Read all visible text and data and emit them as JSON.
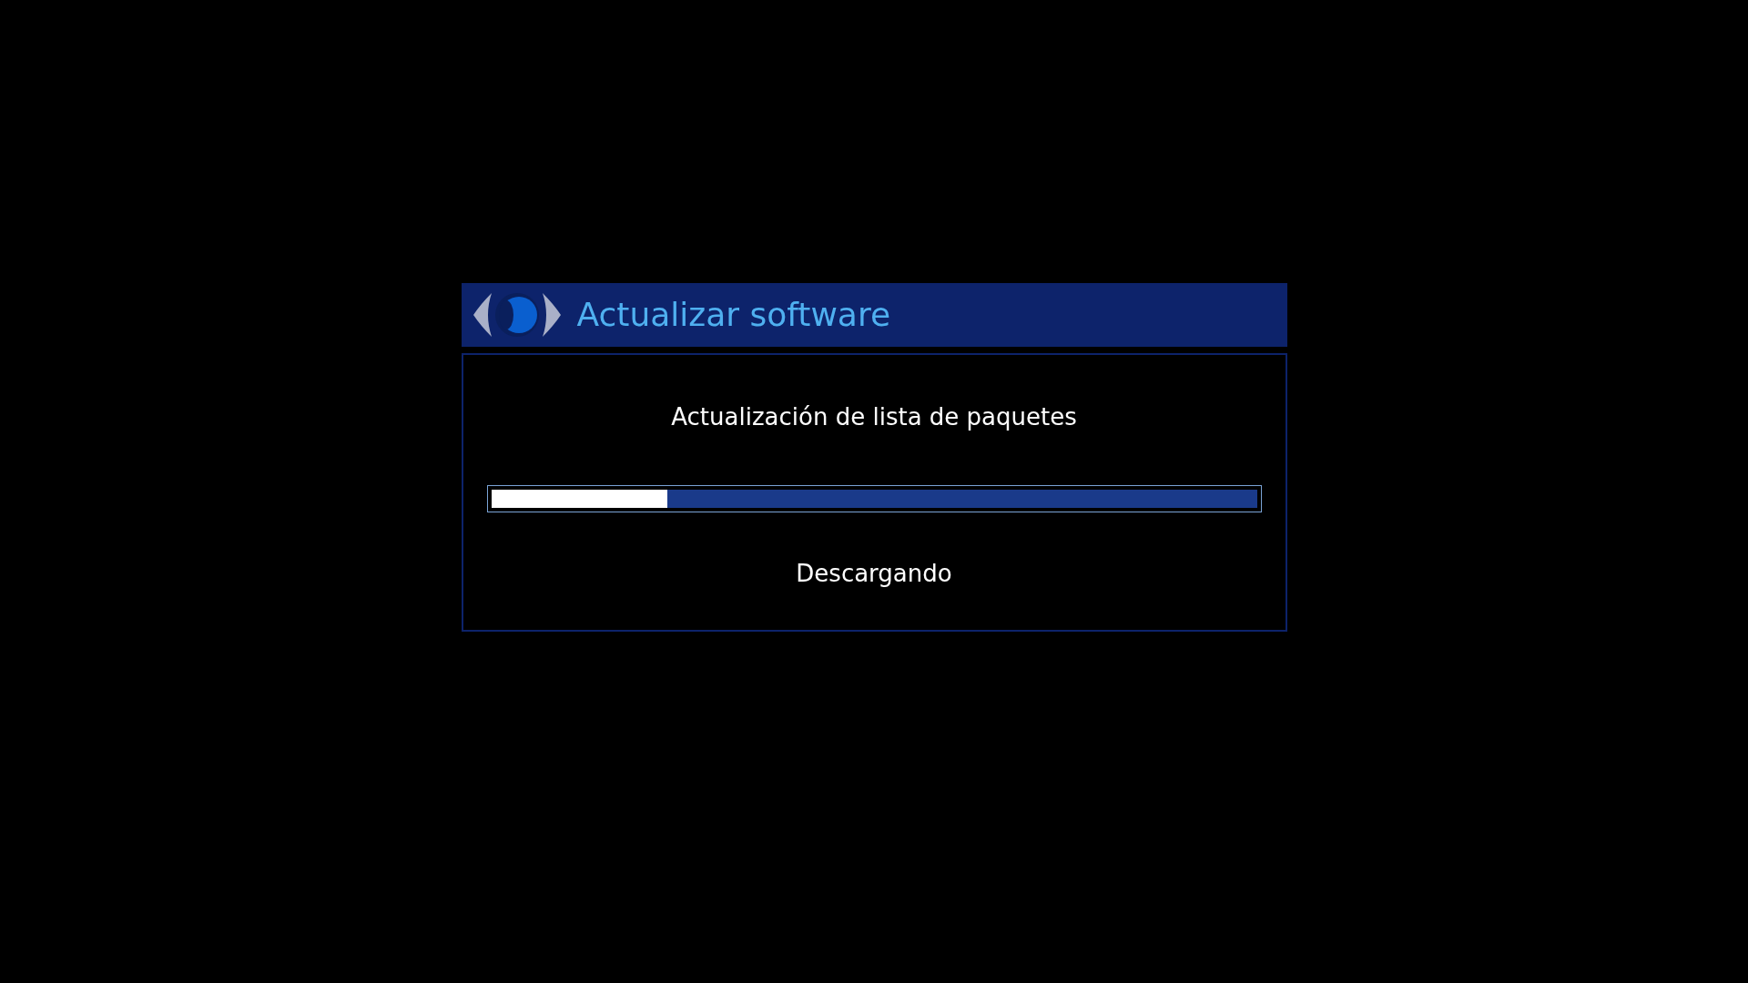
{
  "window": {
    "title": "Actualizar software"
  },
  "message": "Actualización de lista de paquetes",
  "progress": {
    "level": 0.23
  },
  "status": "Descargando"
}
